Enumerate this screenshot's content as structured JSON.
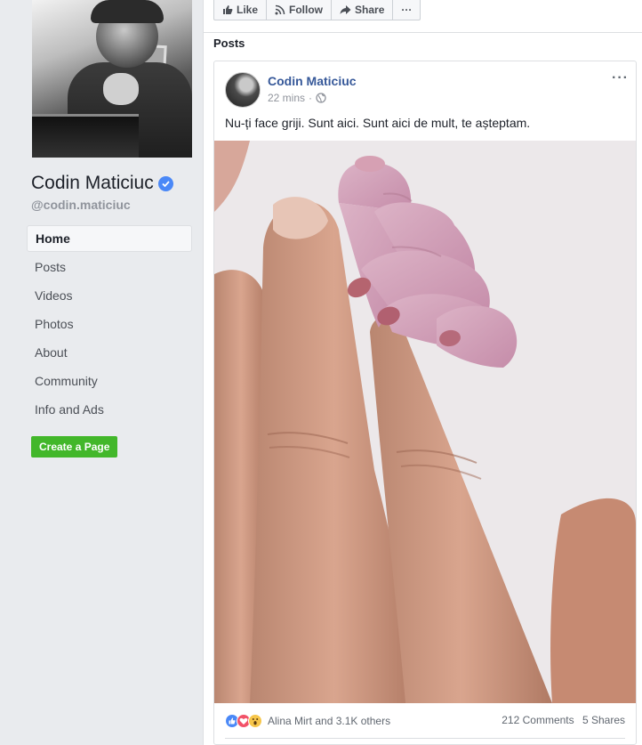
{
  "page": {
    "name": "Codin Maticiuc",
    "handle": "@codin.maticiuc"
  },
  "nav": {
    "items": [
      {
        "label": "Home",
        "active": true
      },
      {
        "label": "Posts",
        "active": false
      },
      {
        "label": "Videos",
        "active": false
      },
      {
        "label": "Photos",
        "active": false
      },
      {
        "label": "About",
        "active": false
      },
      {
        "label": "Community",
        "active": false
      },
      {
        "label": "Info and Ads",
        "active": false
      }
    ]
  },
  "create_page_label": "Create a Page",
  "action_bar": {
    "like_label": "Like",
    "follow_label": "Follow",
    "share_label": "Share",
    "more_label": "···"
  },
  "posts_heading": "Posts",
  "post": {
    "author": "Codin Maticiuc",
    "time": "22 mins",
    "meta_separator": "·",
    "text": "Nu-ți face griji. Sunt aici. Sunt aici de mult, te așteptam.",
    "options_label": "···",
    "reaction_names": "Alina Mirt and 3.1K others",
    "comments": "212 Comments",
    "shares": "5 Shares"
  },
  "colors": {
    "link_blue": "#365899",
    "verified_blue": "#4a88f7",
    "create_green": "#42b72a",
    "background": "#e9ebee"
  },
  "icons": {
    "verified": "verified-badge-icon",
    "like": "thumbs-up-icon",
    "follow": "rss-icon",
    "share": "share-arrow-icon",
    "privacy": "globe-icon"
  }
}
